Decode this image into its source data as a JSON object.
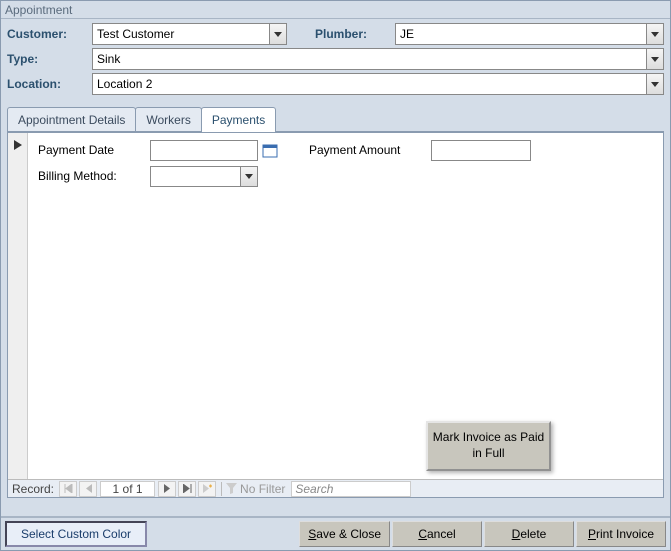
{
  "window": {
    "title": "Appointment"
  },
  "header": {
    "customer_label": "Customer:",
    "customer_value": "Test Customer",
    "plumber_label": "Plumber:",
    "plumber_value": "JE",
    "type_label": "Type:",
    "type_value": "Sink",
    "location_label": "Location:",
    "location_value": "Location 2"
  },
  "tabs": {
    "items": [
      "Appointment Details",
      "Workers",
      "Payments"
    ],
    "active_index": 2
  },
  "payments": {
    "date_label": "Payment Date",
    "date_value": "",
    "amount_label": "Payment Amount",
    "amount_value": "",
    "billing_label": "Billing Method:",
    "billing_value": "",
    "mark_paid_label": "Mark Invoice as Paid in Full"
  },
  "record_nav": {
    "label": "Record:",
    "counter": "1 of 1",
    "filter_label": "No Filter",
    "search_placeholder": "Search"
  },
  "footer": {
    "custom_color": "Select Custom Color",
    "save": "Save & Close",
    "cancel": "Cancel",
    "delete": "Delete",
    "print": "Print Invoice"
  }
}
